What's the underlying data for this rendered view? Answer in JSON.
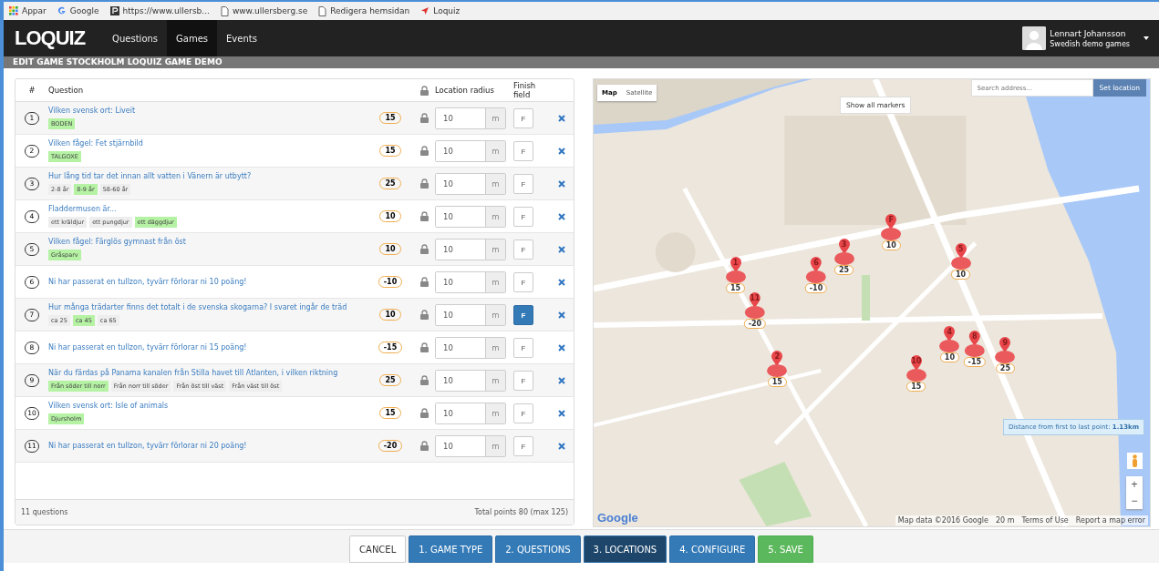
{
  "bookmarks": [
    {
      "kind": "apps",
      "label": "Appar"
    },
    {
      "kind": "google",
      "label": "Google"
    },
    {
      "kind": "p",
      "label": "https://www.ullersb..."
    },
    {
      "kind": "page",
      "label": "www.ullersberg.se"
    },
    {
      "kind": "page",
      "label": "Redigera hemsidan"
    },
    {
      "kind": "arrow",
      "label": "Loquiz"
    }
  ],
  "logo": "LOQUIZ",
  "nav": [
    {
      "label": "Questions",
      "selected": false
    },
    {
      "label": "Games",
      "selected": true
    },
    {
      "label": "Events",
      "selected": false
    }
  ],
  "user": {
    "name": "Lennart Johansson",
    "subtitle": "Swedish demo games"
  },
  "page_title": "EDIT GAME STOCKHOLM LOQUIZ GAME DEMO",
  "table": {
    "columns": [
      "#",
      "Question",
      "Location radius",
      "Finish field"
    ],
    "rows": [
      {
        "number": "1",
        "question": "Vilken svensk ort: Liveit",
        "points": "15",
        "radius": "10",
        "unit": "m",
        "finish": "F",
        "finish_selected": false,
        "answers": [
          {
            "text": "BODEN",
            "correct": true
          }
        ]
      },
      {
        "number": "2",
        "question": "Vilken fågel: Fet stjärnbild",
        "points": "15",
        "radius": "10",
        "unit": "m",
        "finish": "F",
        "finish_selected": false,
        "answers": [
          {
            "text": "TALGOXE",
            "correct": true
          }
        ]
      },
      {
        "number": "3",
        "question": "Hur lång tid tar det innan allt vatten i Vänern är utbytt?",
        "points": "25",
        "radius": "10",
        "unit": "m",
        "finish": "F",
        "finish_selected": false,
        "answers": [
          {
            "text": "2-8 år",
            "correct": false
          },
          {
            "text": "8-9 år",
            "correct": true
          },
          {
            "text": "58-60 år",
            "correct": false
          }
        ]
      },
      {
        "number": "4",
        "question": "Fladdermusen är...",
        "points": "10",
        "radius": "10",
        "unit": "m",
        "finish": "F",
        "finish_selected": false,
        "answers": [
          {
            "text": "ett kräldjur",
            "correct": false
          },
          {
            "text": "ett pungdjur",
            "correct": false
          },
          {
            "text": "ett däggdjur",
            "correct": true
          }
        ]
      },
      {
        "number": "5",
        "question": "Vilken fågel: Färglös gymnast från öst",
        "points": "10",
        "radius": "10",
        "unit": "m",
        "finish": "F",
        "finish_selected": false,
        "answers": [
          {
            "text": "Gråsparv",
            "correct": true
          }
        ]
      },
      {
        "number": "6",
        "question": "Ni har passerat en tullzon, tyvärr förlorar ni 10 poäng!",
        "points": "-10",
        "radius": "10",
        "unit": "m",
        "finish": "F",
        "finish_selected": false,
        "answers": []
      },
      {
        "number": "7",
        "question": "Hur många trädarter finns det totalt i de svenska skogarna? I svaret ingår de träd",
        "points": "10",
        "radius": "10",
        "unit": "m",
        "finish": "F",
        "finish_selected": true,
        "answers": [
          {
            "text": "ca 25",
            "correct": false
          },
          {
            "text": "ca 45",
            "correct": true
          },
          {
            "text": "ca 65",
            "correct": false
          }
        ]
      },
      {
        "number": "8",
        "question": "Ni har passerat en tullzon, tyvärr förlorar ni 15 poäng!",
        "points": "-15",
        "radius": "10",
        "unit": "m",
        "finish": "F",
        "finish_selected": false,
        "answers": []
      },
      {
        "number": "9",
        "question": "När du färdas på Panama kanalen från Stilla havet till Atlanten, i vilken riktning",
        "points": "25",
        "radius": "10",
        "unit": "m",
        "finish": "F",
        "finish_selected": false,
        "answers": [
          {
            "text": "Från söder till norr",
            "correct": true
          },
          {
            "text": "Från norr till söder",
            "correct": false
          },
          {
            "text": "Från öst till väst",
            "correct": false
          },
          {
            "text": "Från väst till öst",
            "correct": false
          }
        ]
      },
      {
        "number": "10",
        "question": "Vilken svensk ort: Isle of animals",
        "points": "15",
        "radius": "10",
        "unit": "m",
        "finish": "F",
        "finish_selected": false,
        "answers": [
          {
            "text": "Djursholm",
            "correct": true
          }
        ]
      },
      {
        "number": "11",
        "question": "Ni har passerat en tullzon, tyvärr förlorar ni 20 poäng!",
        "points": "-20",
        "radius": "10",
        "unit": "m",
        "finish": "F",
        "finish_selected": false,
        "answers": []
      }
    ],
    "count": "11 questions",
    "total": "Total points 80 (max 125)"
  },
  "map": {
    "types": [
      {
        "label": "Map",
        "selected": true
      },
      {
        "label": "Satellite",
        "selected": false
      }
    ],
    "show_markers": "Show all markers",
    "search_placeholder": "Search address...",
    "set_location": "Set location",
    "markers": [
      {
        "label": "F",
        "points": "10"
      },
      {
        "label": "1",
        "points": "15"
      },
      {
        "label": "11",
        "points": "-20"
      },
      {
        "label": "6",
        "points": "-10"
      },
      {
        "label": "3",
        "points": "25"
      },
      {
        "label": "5",
        "points": "10"
      },
      {
        "label": "2",
        "points": "15"
      },
      {
        "label": "10",
        "points": "15"
      },
      {
        "label": "4",
        "points": "10"
      },
      {
        "label": "8",
        "points": "-15"
      },
      {
        "label": "9",
        "points": "25"
      }
    ],
    "distance": "Distance from first to last point: **1.13km**",
    "zoom_in": "+",
    "zoom_out": "−",
    "google": "Google",
    "attribution": [
      "Map data ©2016 Google",
      "20 m",
      "Terms of Use",
      "Report a map error"
    ]
  },
  "steps": [
    {
      "kind": "cancel",
      "label": "CANCEL",
      "selected": false
    },
    {
      "kind": "step",
      "label": "1. GAME TYPE",
      "selected": false
    },
    {
      "kind": "step",
      "label": "2. QUESTIONS",
      "selected": false
    },
    {
      "kind": "step",
      "label": "3. LOCATIONS",
      "selected": true
    },
    {
      "kind": "step",
      "label": "4. CONFIGURE",
      "selected": false
    },
    {
      "kind": "save",
      "label": "5. SAVE",
      "selected": false
    }
  ]
}
